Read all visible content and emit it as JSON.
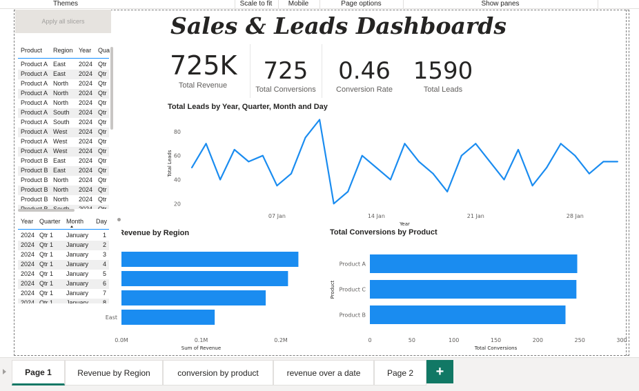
{
  "ribbon": {
    "items": [
      "Themes",
      "Scale to fit",
      "Mobile",
      "Page options",
      "Show panes"
    ]
  },
  "apply_slicers_label": "Apply all slicers",
  "title": "Sales & Leads Dashboards",
  "kpis": [
    {
      "value": "725K",
      "label": "Total Revenue"
    },
    {
      "value": "725",
      "label": "Total Conversions"
    },
    {
      "value": "0.46",
      "label": "Conversion Rate"
    },
    {
      "value": "1590",
      "label": "Total Leads"
    }
  ],
  "table1": {
    "headers": [
      "Product",
      "Region",
      "Year",
      "Qua"
    ],
    "rows": [
      [
        "Product A",
        "East",
        "2024",
        "Qtr"
      ],
      [
        "Product A",
        "East",
        "2024",
        "Qtr"
      ],
      [
        "Product A",
        "North",
        "2024",
        "Qtr"
      ],
      [
        "Product A",
        "North",
        "2024",
        "Qtr"
      ],
      [
        "Product A",
        "North",
        "2024",
        "Qtr"
      ],
      [
        "Product A",
        "South",
        "2024",
        "Qtr"
      ],
      [
        "Product A",
        "South",
        "2024",
        "Qtr"
      ],
      [
        "Product A",
        "West",
        "2024",
        "Qtr"
      ],
      [
        "Product A",
        "West",
        "2024",
        "Qtr"
      ],
      [
        "Product A",
        "West",
        "2024",
        "Qtr"
      ],
      [
        "Product B",
        "East",
        "2024",
        "Qtr"
      ],
      [
        "Product B",
        "East",
        "2024",
        "Qtr"
      ],
      [
        "Product B",
        "North",
        "2024",
        "Qtr"
      ],
      [
        "Product B",
        "North",
        "2024",
        "Qtr"
      ],
      [
        "Product B",
        "North",
        "2024",
        "Qtr"
      ],
      [
        "Product B",
        "South",
        "2024",
        "Qtr"
      ]
    ]
  },
  "table2": {
    "headers": [
      "Year",
      "Quarter",
      "Month",
      "Day"
    ],
    "rows": [
      [
        "2024",
        "Qtr 1",
        "January",
        "1"
      ],
      [
        "2024",
        "Qtr 1",
        "January",
        "2"
      ],
      [
        "2024",
        "Qtr 1",
        "January",
        "3"
      ],
      [
        "2024",
        "Qtr 1",
        "January",
        "4"
      ],
      [
        "2024",
        "Qtr 1",
        "January",
        "5"
      ],
      [
        "2024",
        "Qtr 1",
        "January",
        "6"
      ],
      [
        "2024",
        "Qtr 1",
        "January",
        "7"
      ],
      [
        "2024",
        "Qtr 1",
        "January",
        "8"
      ]
    ]
  },
  "colors": {
    "bar": "#1a8cf0",
    "line": "#1a8cf0",
    "tab_accent": "#117865"
  },
  "chart_data": [
    {
      "type": "line",
      "title": "Total Leads by Year, Quarter, Month and Day",
      "xlabel": "Year",
      "ylabel": "Total Leads",
      "x_ticks": [
        "07 Jan",
        "14 Jan",
        "21 Jan",
        "28 Jan"
      ],
      "y_ticks": [
        20,
        40,
        60,
        80
      ],
      "ylim": [
        15,
        92
      ],
      "xlim": [
        1,
        31
      ],
      "x": [
        1,
        2,
        3,
        4,
        5,
        6,
        7,
        8,
        9,
        10,
        11,
        12,
        13,
        14,
        15,
        16,
        17,
        18,
        19,
        20,
        21,
        22,
        23,
        24,
        25,
        26,
        27,
        28,
        29,
        30,
        31
      ],
      "values": [
        50,
        70,
        40,
        65,
        55,
        60,
        35,
        45,
        75,
        90,
        20,
        30,
        60,
        50,
        40,
        70,
        55,
        45,
        30,
        60,
        70,
        55,
        40,
        65,
        35,
        50,
        70,
        60,
        45,
        55,
        55
      ],
      "grid": false
    },
    {
      "type": "bar",
      "orientation": "horizontal",
      "title": "Revenue by Region",
      "xlabel": "Sum of Revenue",
      "ylabel": "",
      "categories": [
        "",
        "",
        "",
        "East"
      ],
      "values": [
        0.222,
        0.209,
        0.181,
        0.117
      ],
      "x_ticks": [
        "0.0M",
        "0.1M",
        "0.2M"
      ],
      "xlim": [
        0,
        0.2
      ]
    },
    {
      "type": "bar",
      "orientation": "horizontal",
      "title": "Total Conversions by Product",
      "xlabel": "Total Conversions",
      "ylabel": "Product",
      "categories": [
        "Product A",
        "Product C",
        "Product B"
      ],
      "values": [
        247,
        246,
        233
      ],
      "x_ticks": [
        "0",
        "50",
        "100",
        "150",
        "200",
        "250",
        "300"
      ],
      "xlim": [
        0,
        300
      ]
    }
  ],
  "tabs": [
    {
      "label": "Page 1",
      "active": true
    },
    {
      "label": "Revenue by Region",
      "active": false
    },
    {
      "label": "conversion by product",
      "active": false
    },
    {
      "label": "revenue over a date",
      "active": false
    },
    {
      "label": "Page 2",
      "active": false
    }
  ],
  "add_tab_label": "+"
}
